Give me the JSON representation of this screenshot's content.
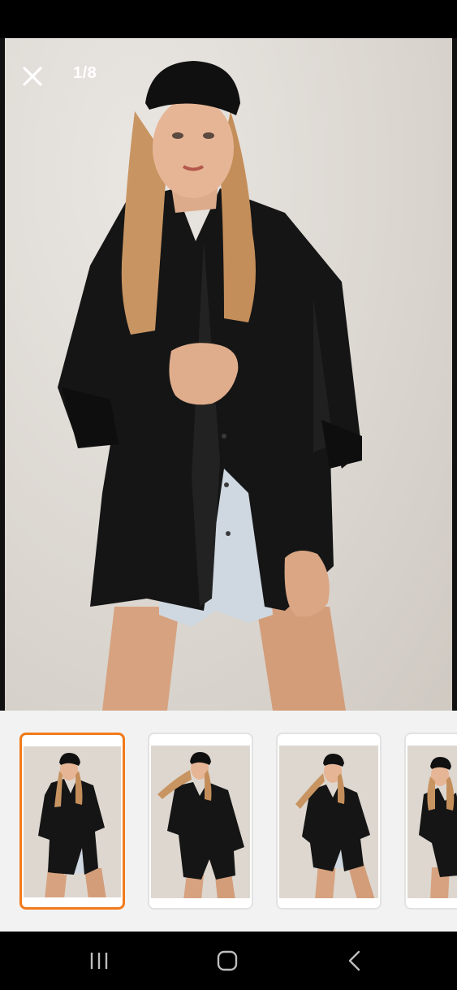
{
  "viewer": {
    "counter": "1/8",
    "current_index": 1,
    "total": 8
  },
  "icons": {
    "close": "close-icon",
    "recents": "recents-icon",
    "home": "home-icon",
    "back": "back-icon"
  },
  "thumbnails": [
    {
      "label": "",
      "selected": true
    },
    {
      "label": "",
      "selected": false
    },
    {
      "label": "",
      "selected": false
    },
    {
      "label": "",
      "selected": false
    }
  ],
  "colors": {
    "accent": "#f27a1a",
    "overlay_text": "#ffffff",
    "thumb_strip_bg": "#f2f2f2",
    "nav_bg": "#000000"
  }
}
